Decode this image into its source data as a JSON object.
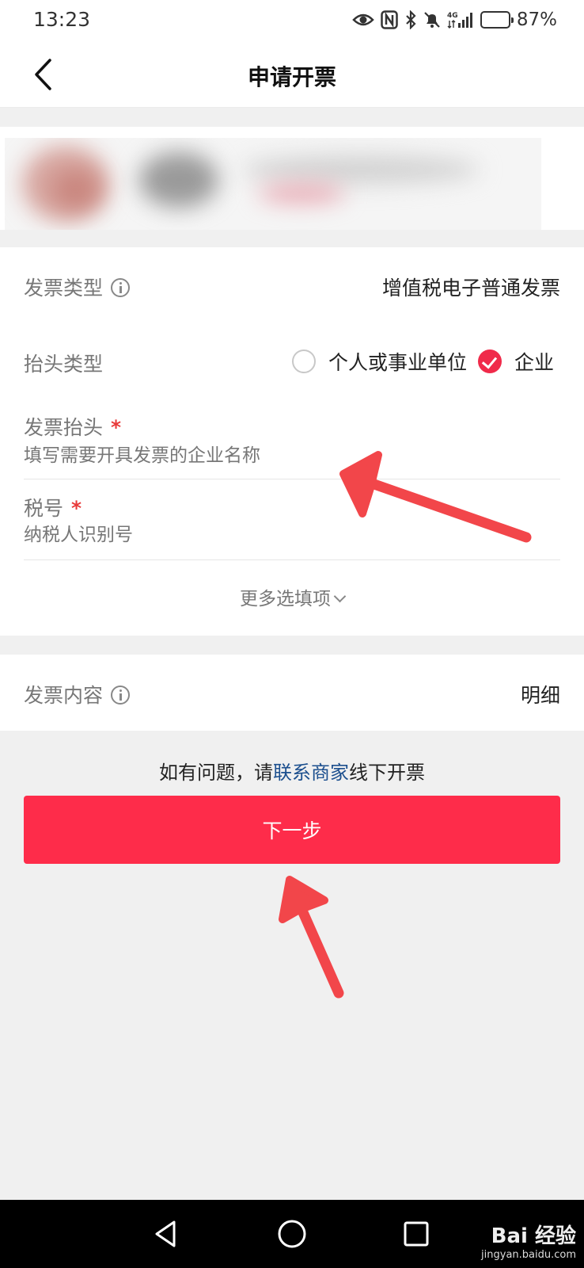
{
  "status_bar": {
    "time": "13:23",
    "battery_text": "87%",
    "battery_level": 0.87,
    "icons": [
      "eye-icon",
      "nfc-icon",
      "bluetooth-icon",
      "mute-icon",
      "signal-4g-icon",
      "battery-icon"
    ]
  },
  "nav": {
    "title": "申请开票",
    "back_icon": "back-chevron-icon"
  },
  "invoice_type": {
    "label": "发票类型",
    "value": "增值税电子普通发票"
  },
  "header_type": {
    "label": "抬头类型",
    "options": [
      {
        "label": "个人或事业单位",
        "selected": false
      },
      {
        "label": "企业",
        "selected": true
      }
    ]
  },
  "fields": {
    "title": {
      "label": "发票抬头",
      "required_mark": "*",
      "placeholder": "填写需要开具发票的企业名称",
      "value": ""
    },
    "tax_id": {
      "label": "税号",
      "required_mark": "*",
      "placeholder": "纳税人识别号",
      "value": ""
    }
  },
  "more_options": {
    "label": "更多选填项"
  },
  "invoice_content": {
    "label": "发票内容",
    "value": "明细"
  },
  "help": {
    "prefix": "如有问题，请",
    "link": "联系商家",
    "suffix": "线下开票"
  },
  "next_button": {
    "label": "下一步"
  },
  "colors": {
    "accent": "#fe2c4a",
    "link": "#1c4f8e",
    "annotation_arrow": "#f2464a"
  },
  "watermark": {
    "logo": "Bai 经验",
    "url": "jingyan.baidu.com"
  }
}
